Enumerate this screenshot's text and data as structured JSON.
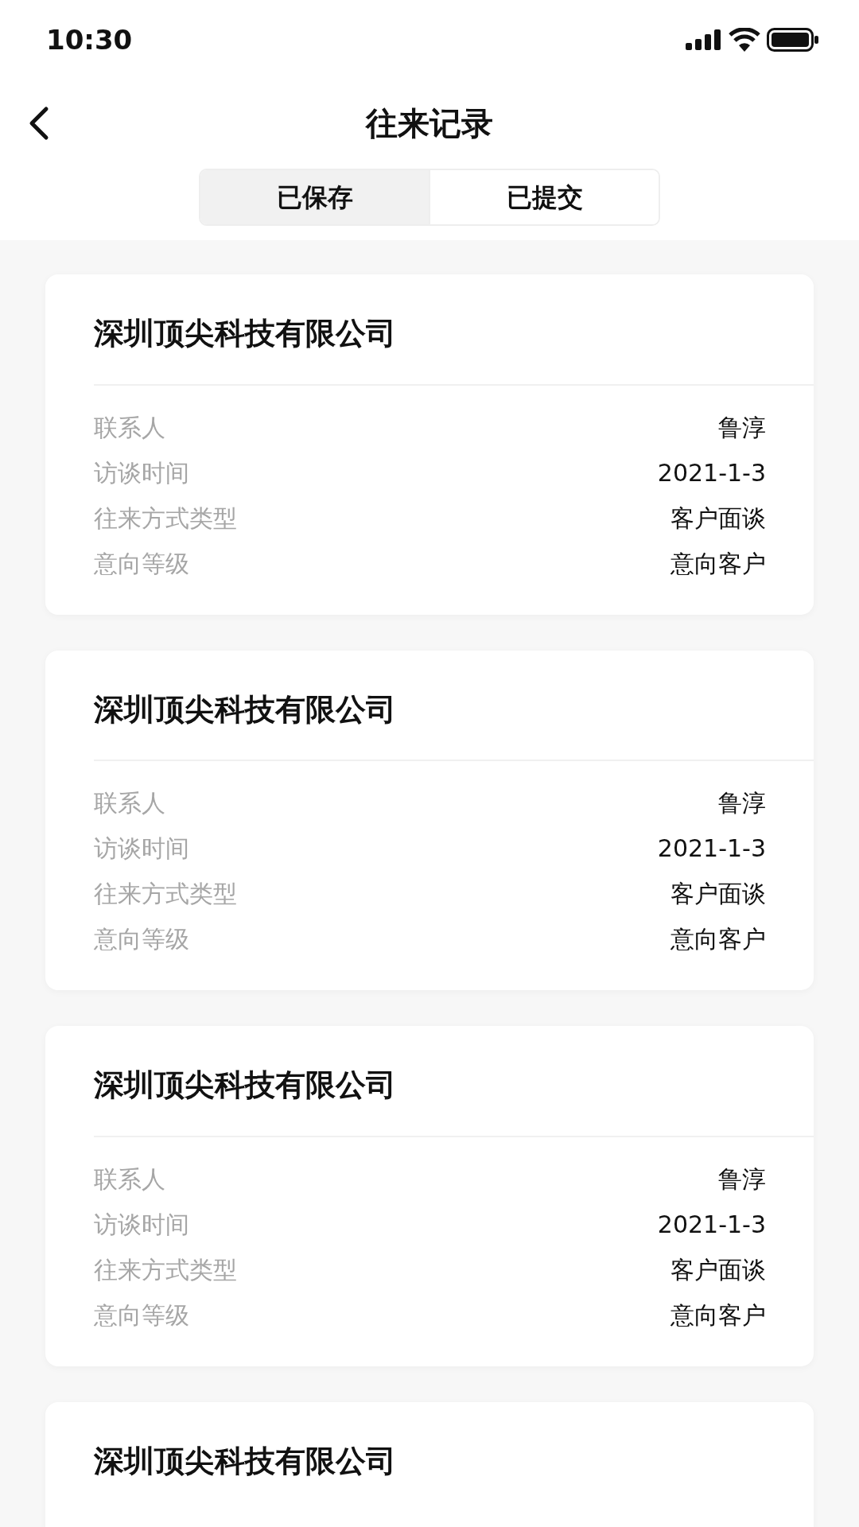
{
  "status_bar": {
    "time": "10:30"
  },
  "nav": {
    "title": "往来记录"
  },
  "tabs": [
    {
      "label": "已保存",
      "selected": true
    },
    {
      "label": "已提交",
      "selected": false
    }
  ],
  "records": [
    {
      "company": "深圳顶尖科技有限公司",
      "fields": [
        {
          "label": "联系人",
          "value": "鲁淳"
        },
        {
          "label": "访谈时间",
          "value": "2021-1-3"
        },
        {
          "label": "往来方式类型",
          "value": "客户面谈"
        },
        {
          "label": "意向等级",
          "value": "意向客户"
        }
      ]
    },
    {
      "company": "深圳顶尖科技有限公司",
      "fields": [
        {
          "label": "联系人",
          "value": "鲁淳"
        },
        {
          "label": "访谈时间",
          "value": "2021-1-3"
        },
        {
          "label": "往来方式类型",
          "value": "客户面谈"
        },
        {
          "label": "意向等级",
          "value": "意向客户"
        }
      ]
    },
    {
      "company": "深圳顶尖科技有限公司",
      "fields": [
        {
          "label": "联系人",
          "value": "鲁淳"
        },
        {
          "label": "访谈时间",
          "value": "2021-1-3"
        },
        {
          "label": "往来方式类型",
          "value": "客户面谈"
        },
        {
          "label": "意向等级",
          "value": "意向客户"
        }
      ]
    },
    {
      "company": "深圳顶尖科技有限公司"
    }
  ]
}
